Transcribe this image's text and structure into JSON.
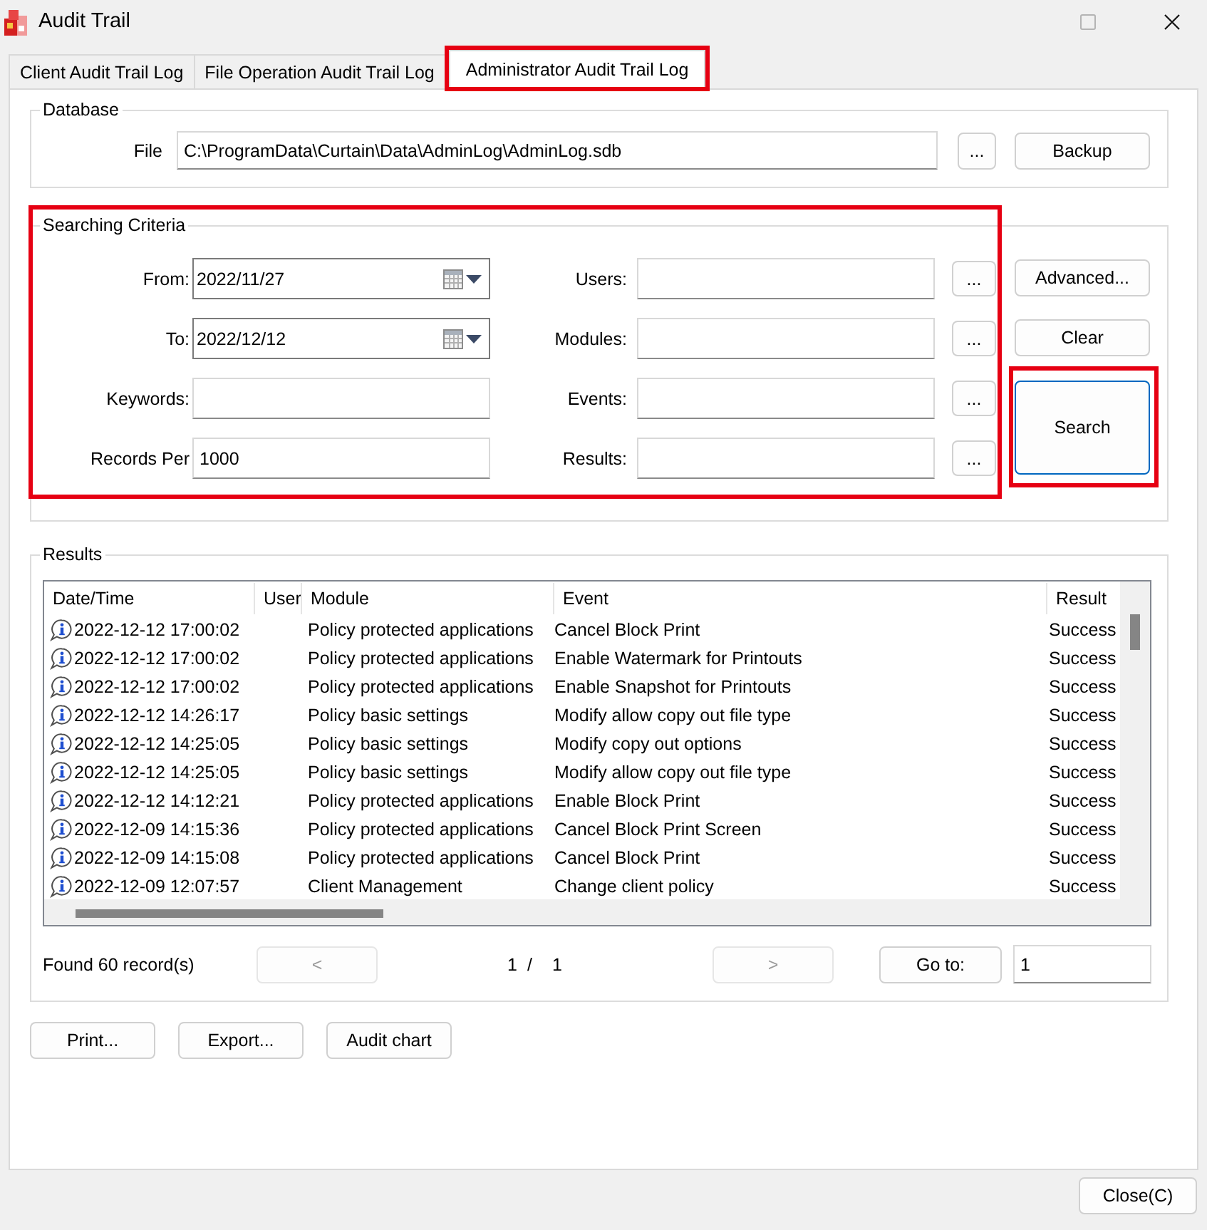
{
  "window": {
    "title": "Audit Trail",
    "controls": [
      {
        "kind": "maximize",
        "disabled": true
      },
      {
        "kind": "close",
        "disabled": false
      }
    ]
  },
  "tabs": [
    {
      "label": "Client Audit Trail Log",
      "selected": false,
      "highlighted": false
    },
    {
      "label": "File Operation Audit Trail Log",
      "selected": false,
      "highlighted": false
    },
    {
      "label": "Administrator Audit Trail Log",
      "selected": true,
      "highlighted": true
    }
  ],
  "database": {
    "legend": "Database",
    "file_label": "File",
    "file_path": "C:\\ProgramData\\Curtain\\Data\\AdminLog\\AdminLog.sdb",
    "browse_button": "...",
    "backup_button": "Backup"
  },
  "criteria": {
    "legend": "Searching Criteria",
    "highlighted": true,
    "left_fields": [
      {
        "label": "From:",
        "value": "2022/11/27",
        "kind": "date"
      },
      {
        "label": "To:",
        "value": "2022/12/12",
        "kind": "date"
      },
      {
        "label": "Keywords:",
        "kind": "text"
      },
      {
        "label": "Records Per",
        "value": "1000",
        "kind": "text"
      }
    ],
    "right_fields": [
      {
        "label": "Users:",
        "browse_button": "..."
      },
      {
        "label": "Modules:",
        "browse_button": "..."
      },
      {
        "label": "Events:",
        "browse_button": "..."
      },
      {
        "label": "Results:",
        "browse_button": "..."
      }
    ],
    "buttons": [
      {
        "label": "Advanced...",
        "default": false,
        "highlighted": false
      },
      {
        "label": "Clear",
        "default": false,
        "highlighted": false
      },
      {
        "label": "Search",
        "default": true,
        "highlighted": true
      }
    ]
  },
  "results": {
    "legend": "Results",
    "columns": [
      "Date/Time",
      "User",
      "Module",
      "Event",
      "Result"
    ],
    "rows": [
      {
        "date_time": "2022-12-12 17:00:02",
        "module": "Policy protected applications",
        "event": "Cancel Block Print",
        "result": "Success"
      },
      {
        "date_time": "2022-12-12 17:00:02",
        "module": "Policy protected applications",
        "event": "Enable Watermark for Printouts",
        "result": "Success"
      },
      {
        "date_time": "2022-12-12 17:00:02",
        "module": "Policy protected applications",
        "event": "Enable Snapshot for Printouts",
        "result": "Success"
      },
      {
        "date_time": "2022-12-12 14:26:17",
        "module": "Policy basic settings",
        "event": "Modify allow copy out file type",
        "result": "Success"
      },
      {
        "date_time": "2022-12-12 14:25:05",
        "module": "Policy basic settings",
        "event": "Modify copy out options",
        "result": "Success"
      },
      {
        "date_time": "2022-12-12 14:25:05",
        "module": "Policy basic settings",
        "event": "Modify allow copy out file type",
        "result": "Success"
      },
      {
        "date_time": "2022-12-12 14:12:21",
        "module": "Policy protected applications",
        "event": "Enable Block Print",
        "result": "Success"
      },
      {
        "date_time": "2022-12-09 14:15:36",
        "module": "Policy protected applications",
        "event": "Cancel Block Print Screen",
        "result": "Success"
      },
      {
        "date_time": "2022-12-09 14:15:08",
        "module": "Policy protected applications",
        "event": "Cancel Block Print",
        "result": "Success"
      },
      {
        "date_time": "2022-12-09 12:07:57",
        "module": "Client Management",
        "event": "Change client policy",
        "result": "Success"
      }
    ],
    "found": "Found 60 record(s)",
    "prev_button": {
      "label": "<",
      "disabled": true
    },
    "page": {
      "current": "1",
      "separator": "/",
      "total": "1"
    },
    "next_button": {
      "label": ">",
      "disabled": true
    },
    "goto_button": "Go to:",
    "goto_value": "1"
  },
  "actions": [
    "Print...",
    "Export...",
    "Audit chart"
  ],
  "close_button": "Close(C)"
}
